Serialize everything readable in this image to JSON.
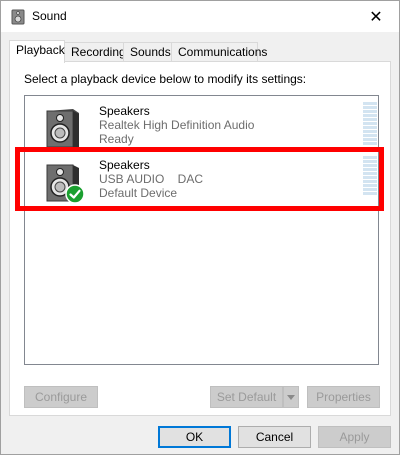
{
  "window": {
    "title": "Sound",
    "title_icon": "speaker-icon",
    "close_glyph": "✕"
  },
  "tabs": [
    {
      "label": "Playback",
      "active": true
    },
    {
      "label": "Recording",
      "active": false
    },
    {
      "label": "Sounds",
      "active": false
    },
    {
      "label": "Communications",
      "active": false
    }
  ],
  "panel": {
    "instruction": "Select a playback device below to modify its settings:"
  },
  "devices": [
    {
      "name": "Speakers",
      "line2": "Realtek High Definition Audio",
      "line3": "Ready",
      "icon": "speaker-icon",
      "is_default": false
    },
    {
      "name": "Speakers",
      "line2": "USB AUDIO    DAC",
      "line3": "Default Device",
      "icon": "speaker-icon",
      "badge_icon": "checkmark-icon",
      "is_default": true
    }
  ],
  "panel_buttons": {
    "configure": {
      "label": "Configure",
      "enabled": false
    },
    "set_default": {
      "label": "Set Default",
      "enabled": false
    },
    "properties": {
      "label": "Properties",
      "enabled": false
    }
  },
  "dialog_buttons": {
    "ok": {
      "label": "OK",
      "enabled": true
    },
    "cancel": {
      "label": "Cancel",
      "enabled": true
    },
    "apply": {
      "label": "Apply",
      "enabled": false
    }
  },
  "colors": {
    "highlight": "#ff0000",
    "default_badge": "#1a9f2f",
    "focus_border": "#0078d7",
    "meter": "#d3e4f1"
  }
}
